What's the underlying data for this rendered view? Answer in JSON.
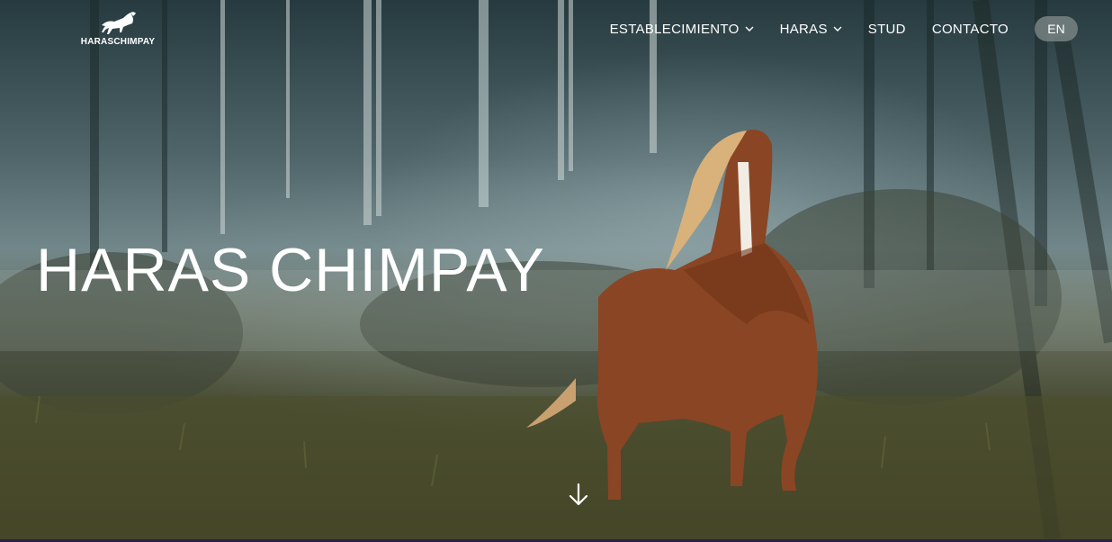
{
  "logo": {
    "text": "HARASCHIMPAY",
    "icon": "horse-logo-icon"
  },
  "nav": {
    "items": [
      {
        "label": "ESTABLECIMIENTO",
        "has_dropdown": true
      },
      {
        "label": "HARAS",
        "has_dropdown": true
      },
      {
        "label": "STUD",
        "has_dropdown": false
      },
      {
        "label": "CONTACTO",
        "has_dropdown": false
      }
    ],
    "language": "EN"
  },
  "hero": {
    "title": "HARAS CHIMPAY",
    "scroll_icon": "arrow-down-icon",
    "image": "chestnut-horse-running-in-misty-forest"
  },
  "colors": {
    "text": "#ffffff",
    "lang_pill": "#7a8282",
    "bottom_bar": "#2a2145"
  }
}
